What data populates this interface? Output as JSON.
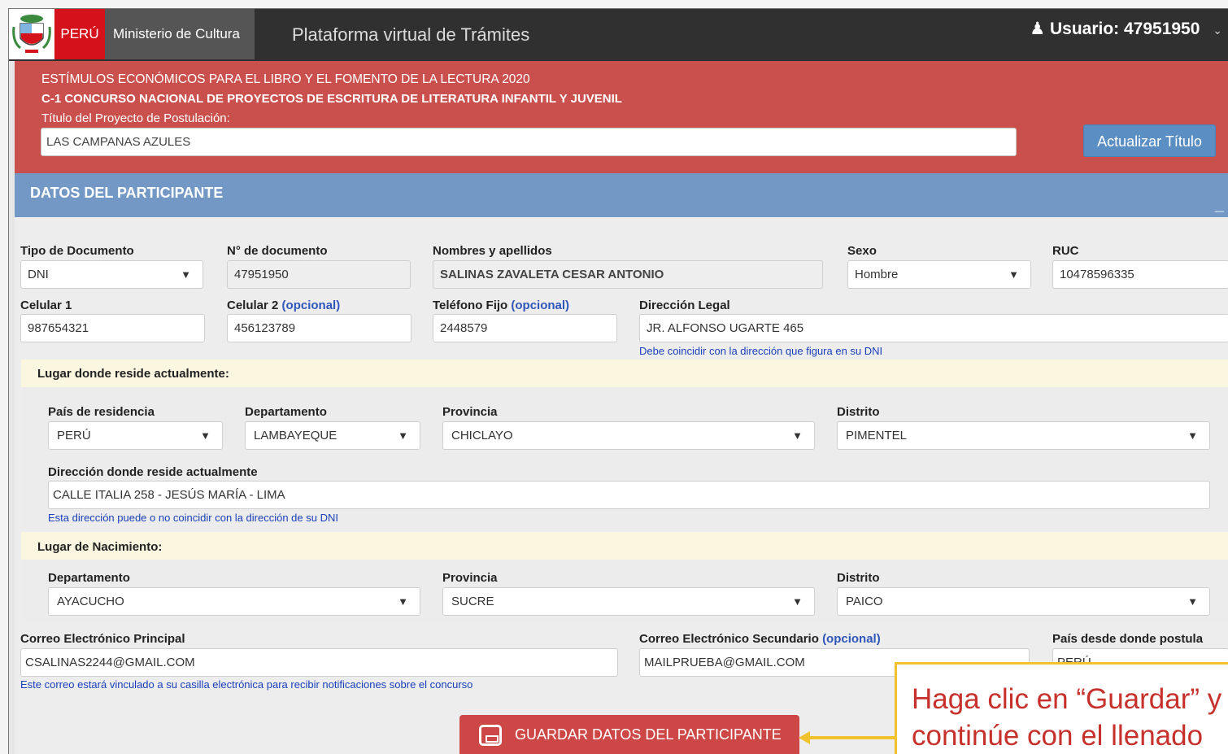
{
  "navbar": {
    "peru": "PERÚ",
    "ministry": "Ministerio de Cultura",
    "title": "Plataforma virtual de Trámites",
    "user": "Usuario: 47951950"
  },
  "header": {
    "line1": "ESTÍMULOS ECONÓMICOS PARA EL LIBRO Y EL FOMENTO DE LA LECTURA 2020",
    "line2": "C-1 CONCURSO NACIONAL DE PROYECTOS DE ESCRITURA DE LITERATURA INFANTIL Y JUVENIL",
    "title_label": "Título del Proyecto de Postulación:",
    "title_value": "LAS CAMPANAS AZULES",
    "update_button": "Actualizar Título"
  },
  "section": {
    "title": "DATOS DEL PARTICIPANTE",
    "collapse": "_"
  },
  "fields": {
    "tipo_doc_label": "Tipo de Documento",
    "tipo_doc_value": "DNI",
    "num_doc_label": "N° de documento",
    "num_doc_value": "47951950",
    "nombres_label": "Nombres y apellidos",
    "nombres_value": "SALINAS ZAVALETA CESAR ANTONIO",
    "sexo_label": "Sexo",
    "sexo_value": "Hombre",
    "ruc_label": "RUC",
    "ruc_value": "10478596335",
    "cel1_label": "Celular 1",
    "cel1_value": "987654321",
    "cel2_label": "Celular 2",
    "cel2_value": "456123789",
    "fijo_label": "Teléfono Fijo",
    "fijo_value": "2448579",
    "optional": "(opcional)",
    "dir_legal_label": "Dirección Legal",
    "dir_legal_value": "JR. ALFONSO UGARTE 465",
    "dir_legal_hint": "Debe coincidir con la dirección que figura en su DNI"
  },
  "residence": {
    "heading": "Lugar donde reside actualmente:",
    "pais_label": "País de residencia",
    "pais_value": "PERÚ",
    "depto_label": "Departamento",
    "depto_value": "LAMBAYEQUE",
    "prov_label": "Provincia",
    "prov_value": "CHICLAYO",
    "dist_label": "Distrito",
    "dist_value": "PIMENTEL",
    "dir_label": "Dirección donde reside actualmente",
    "dir_value": "CALLE ITALIA 258 - JESÚS MARÍA - LIMA",
    "dir_hint": "Esta dirección puede o no coincidir con la dirección de su DNI"
  },
  "birth": {
    "heading": "Lugar de Nacimiento:",
    "depto_label": "Departamento",
    "depto_value": "AYACUCHO",
    "prov_label": "Provincia",
    "prov_value": "SUCRE",
    "dist_label": "Distrito",
    "dist_value": "PAICO"
  },
  "contact": {
    "email1_label": "Correo Electrónico Principal",
    "email1_value": "CSALINAS2244@GMAIL.COM",
    "email1_hint": "Este correo estará vinculado a su casilla electrónica para recibir notificaciones sobre el concurso",
    "email2_label": "Correo Electrónico Secundario",
    "email2_value": "MAILPRUEBA@GMAIL.COM",
    "pais_post_label": "País desde donde postula",
    "pais_post_value": "PERÚ"
  },
  "save_button": "GUARDAR DATOS DEL PARTICIPANTE",
  "callout": {
    "line1": "Haga clic en “Guardar” y",
    "line2": "continúe con el llenado"
  },
  "colors": {
    "red": "#c9504d",
    "blue": "#7398c5",
    "navbar": "#303030",
    "callout_border": "#f2c22c"
  }
}
